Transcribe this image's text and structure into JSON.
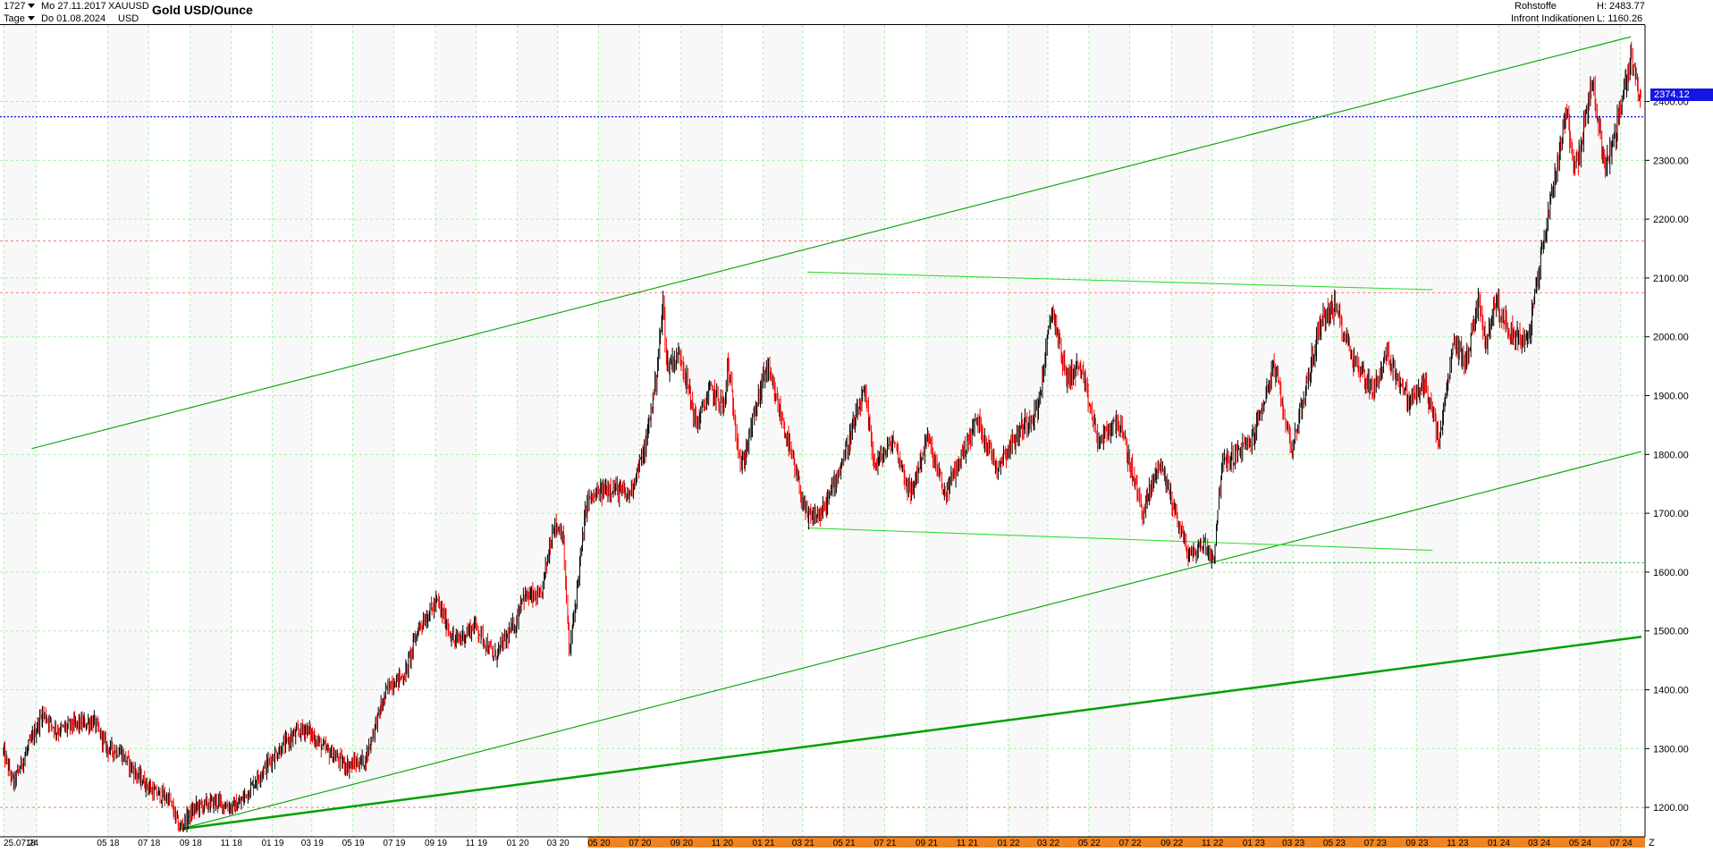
{
  "header": {
    "bar_count": "1727",
    "date_from": "Mo 27.11.2017",
    "symbol": "XAUUSD",
    "interval": "Tage",
    "date_to": "Do 01.08.2024",
    "currency": "USD",
    "title": "Gold USD/Ounce",
    "category": "Rohstoffe",
    "source": "Infront Indikationen",
    "high_label": "H: 2483.77",
    "low_label": "L: 1160.26"
  },
  "price_badge": "2374.12",
  "corner_label": "Z",
  "colors": {
    "up": "#000000",
    "down": "#ff0000",
    "trend": "#00a000",
    "channel_light": "#33dd33",
    "current_line": "#1515e6",
    "ref_line": "#ff8080",
    "grid": "#a8f0a8",
    "band": "#f8f8f8",
    "highlight": "#f08420"
  },
  "chart_data": {
    "type": "candlestick",
    "title": "Gold USD/Ounce",
    "ylim": [
      1150,
      2530
    ],
    "yticks": [
      1200,
      1300,
      1400,
      1500,
      1600,
      1700,
      1800,
      1900,
      2000,
      2100,
      2200,
      2300,
      2400
    ],
    "ytick_labels": [
      "1200.00",
      "1300.00",
      "1400.00",
      "1500.00",
      "1600.00",
      "1700.00",
      "1800.00",
      "1900.00",
      "2000.00",
      "2100.00",
      "2200.00",
      "2300.00",
      "2400.00"
    ],
    "x_range": [
      "2017-11-27",
      "2024-08-01"
    ],
    "xticks": [
      {
        "date": "2017-11-27",
        "label": "25.07.24"
      },
      {
        "date": "2018-01-15",
        "label": "18"
      },
      {
        "date": "2018-05-01",
        "label": "05 18"
      },
      {
        "date": "2018-07-01",
        "label": "07 18"
      },
      {
        "date": "2018-09-01",
        "label": "09 18"
      },
      {
        "date": "2018-11-01",
        "label": "11 18"
      },
      {
        "date": "2019-01-01",
        "label": "01 19"
      },
      {
        "date": "2019-03-01",
        "label": "03 19"
      },
      {
        "date": "2019-05-01",
        "label": "05 19"
      },
      {
        "date": "2019-07-01",
        "label": "07 19"
      },
      {
        "date": "2019-09-01",
        "label": "09 19"
      },
      {
        "date": "2019-11-01",
        "label": "11 19"
      },
      {
        "date": "2020-01-01",
        "label": "01 20"
      },
      {
        "date": "2020-03-01",
        "label": "03 20"
      },
      {
        "date": "2020-05-01",
        "label": "05 20"
      },
      {
        "date": "2020-07-01",
        "label": "07 20"
      },
      {
        "date": "2020-09-01",
        "label": "09 20"
      },
      {
        "date": "2020-11-01",
        "label": "11 20"
      },
      {
        "date": "2021-01-01",
        "label": "01 21"
      },
      {
        "date": "2021-03-01",
        "label": "03 21"
      },
      {
        "date": "2021-05-01",
        "label": "05 21"
      },
      {
        "date": "2021-07-01",
        "label": "07 21"
      },
      {
        "date": "2021-09-01",
        "label": "09 21"
      },
      {
        "date": "2021-11-01",
        "label": "11 21"
      },
      {
        "date": "2022-01-01",
        "label": "01 22"
      },
      {
        "date": "2022-03-01",
        "label": "03 22"
      },
      {
        "date": "2022-05-01",
        "label": "05 22"
      },
      {
        "date": "2022-07-01",
        "label": "07 22"
      },
      {
        "date": "2022-09-01",
        "label": "09 22"
      },
      {
        "date": "2022-11-01",
        "label": "11 22"
      },
      {
        "date": "2023-01-01",
        "label": "01 23"
      },
      {
        "date": "2023-03-01",
        "label": "03 23"
      },
      {
        "date": "2023-05-01",
        "label": "05 23"
      },
      {
        "date": "2023-07-01",
        "label": "07 23"
      },
      {
        "date": "2023-09-01",
        "label": "09 23"
      },
      {
        "date": "2023-11-01",
        "label": "11 23"
      },
      {
        "date": "2024-01-01",
        "label": "01 24"
      },
      {
        "date": "2024-03-01",
        "label": "03 24"
      },
      {
        "date": "2024-05-01",
        "label": "05 24"
      },
      {
        "date": "2024-07-01",
        "label": "07 24"
      }
    ],
    "highlight_range": [
      "2020-04-15",
      "2024-08-01"
    ],
    "series": [
      {
        "x": [
          "2017-11-27",
          "2017-12-12",
          "2018-01-10",
          "2018-01-25",
          "2018-02-15",
          "2018-03-10",
          "2018-04-11",
          "2018-05-01",
          "2018-05-20",
          "2018-06-14",
          "2018-07-10",
          "2018-08-01",
          "2018-08-16",
          "2018-09-10",
          "2018-10-10",
          "2018-11-01",
          "2018-11-13",
          "2018-12-10",
          "2019-01-02",
          "2019-01-31",
          "2019-02-20",
          "2019-03-20",
          "2019-04-23",
          "2019-05-20",
          "2019-06-05",
          "2019-06-25",
          "2019-07-18",
          "2019-08-07",
          "2019-09-04",
          "2019-09-30",
          "2019-10-31",
          "2019-11-28",
          "2019-12-31",
          "2020-01-08",
          "2020-02-05",
          "2020-02-24",
          "2020-03-09",
          "2020-03-19",
          "2020-04-14",
          "2020-05-18",
          "2020-06-15",
          "2020-07-10",
          "2020-07-27",
          "2020-08-06",
          "2020-08-11",
          "2020-09-01",
          "2020-09-24",
          "2020-10-15",
          "2020-11-06",
          "2020-11-09",
          "2020-11-30",
          "2021-01-06",
          "2021-02-01",
          "2021-03-08",
          "2021-03-31",
          "2021-04-30",
          "2021-06-01",
          "2021-06-17",
          "2021-07-15",
          "2021-08-09",
          "2021-09-03",
          "2021-09-29",
          "2021-11-16",
          "2021-12-15",
          "2022-01-25",
          "2022-02-15",
          "2022-03-08",
          "2022-03-29",
          "2022-04-18",
          "2022-05-16",
          "2022-06-14",
          "2022-07-21",
          "2022-08-15",
          "2022-09-28",
          "2022-10-20",
          "2022-11-03",
          "2022-11-15",
          "2022-12-31",
          "2023-02-01",
          "2023-02-28",
          "2023-04-13",
          "2023-05-04",
          "2023-05-31",
          "2023-06-29",
          "2023-07-20",
          "2023-08-21",
          "2023-09-15",
          "2023-10-05",
          "2023-10-27",
          "2023-11-15",
          "2023-12-04",
          "2023-12-13",
          "2023-12-27",
          "2024-01-17",
          "2024-02-14",
          "2024-03-08",
          "2024-04-12",
          "2024-04-22",
          "2024-05-03",
          "2024-05-20",
          "2024-06-07",
          "2024-06-21",
          "2024-07-17",
          "2024-08-01"
        ],
        "y": [
          1295,
          1240,
          1320,
          1360,
          1330,
          1340,
          1345,
          1300,
          1295,
          1255,
          1225,
          1215,
          1165,
          1200,
          1210,
          1200,
          1205,
          1250,
          1285,
          1320,
          1335,
          1300,
          1270,
          1280,
          1345,
          1410,
          1425,
          1505,
          1550,
          1480,
          1510,
          1455,
          1515,
          1560,
          1555,
          1680,
          1670,
          1460,
          1720,
          1745,
          1730,
          1810,
          1940,
          2060,
          1950,
          1970,
          1850,
          1910,
          1880,
          1960,
          1775,
          1950,
          1850,
          1690,
          1700,
          1790,
          1905,
          1780,
          1825,
          1730,
          1830,
          1730,
          1860,
          1780,
          1850,
          1880,
          2050,
          1930,
          1950,
          1820,
          1860,
          1700,
          1790,
          1625,
          1650,
          1620,
          1780,
          1825,
          1950,
          1810,
          2030,
          2050,
          1960,
          1910,
          1970,
          1890,
          1920,
          1820,
          1990,
          1960,
          2070,
          1980,
          2065,
          2010,
          1990,
          2160,
          2390,
          2290,
          2320,
          2440,
          2290,
          2330,
          2480,
          2390
        ]
      }
    ],
    "horizontal_lines": [
      {
        "price": 2374.12,
        "style": "dotted",
        "role": "current"
      },
      {
        "price": 2163,
        "style": "dashed",
        "role": "reference"
      },
      {
        "price": 2075,
        "style": "dashed",
        "role": "reference"
      },
      {
        "price": 1616,
        "style": "dotted",
        "role": "support"
      },
      {
        "price": 1200,
        "style": "dashed",
        "role": "reference"
      }
    ],
    "trendlines": [
      {
        "x1": "2018-01-08",
        "y1": 1810,
        "x2": "2024-07-16",
        "y2": 2510,
        "style": "thin",
        "color": "trend"
      },
      {
        "x1": "2018-08-16",
        "y1": 1163,
        "x2": "2024-08-01",
        "y2": 1805,
        "style": "thin",
        "color": "trend"
      },
      {
        "x1": "2018-08-16",
        "y1": 1163,
        "x2": "2024-08-01",
        "y2": 1490,
        "style": "thick",
        "color": "trend"
      },
      {
        "x1": "2021-03-08",
        "y1": 2110,
        "x2": "2023-09-25",
        "y2": 2080,
        "style": "thin",
        "color": "channel_light"
      },
      {
        "x1": "2021-03-08",
        "y1": 1675,
        "x2": "2023-09-25",
        "y2": 1637,
        "style": "thin",
        "color": "channel_light"
      }
    ]
  }
}
